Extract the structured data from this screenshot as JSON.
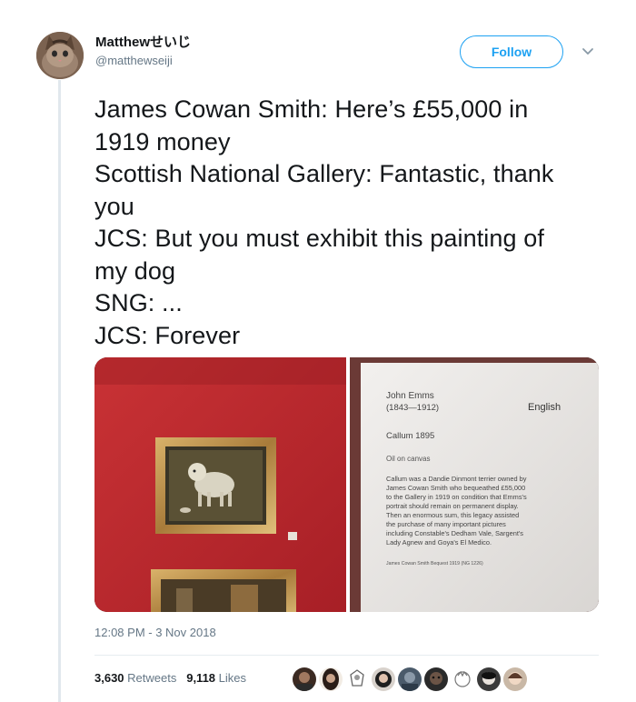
{
  "author": {
    "display_name": "Matthewせいじ",
    "handle": "@matthewseiji",
    "avatar_icon": "cat-avatar"
  },
  "follow_button": {
    "label": "Follow",
    "color": "#1da1f2"
  },
  "more_menu": {
    "icon": "chevron-down-icon"
  },
  "tweet_lines": [
    "James Cowan Smith: Here’s £55,000 in",
    "1919 money",
    "Scottish National Gallery: Fantastic, thank",
    "you",
    "JCS: But you must exhibit this painting of",
    "my dog",
    "SNG: ...",
    "JCS: Forever"
  ],
  "plaque": {
    "artist": "John Emms",
    "dates": "(1843—1912)",
    "language": "English",
    "title": "Callum 1895",
    "medium": "Oil on canvas",
    "description_lines": [
      "Callum was a Dandie Dinmont terrier owned by",
      "James Cowan Smith who bequeathed £55,000",
      "to the Gallery in 1919 on condition that Emms's",
      "portrait should remain on permanent display.",
      "Then an enormous sum, this legacy assisted",
      "the purchase of many important pictures",
      "including Constable's Dedham Vale, Sargent's",
      "Lady Agnew and Goya's El Medico."
    ],
    "credit": "James Cowan Smith Bequest 1919 (NG 1226)"
  },
  "timestamp": "12:08 PM - 3 Nov 2018",
  "stats": {
    "retweets_count": "3,630",
    "retweets_label": "Retweets",
    "likes_count": "9,118",
    "likes_label": "Likes"
  },
  "colors": {
    "gallery_wall": "#b8262d",
    "link_blue": "#1da1f2",
    "muted_text": "#657786"
  }
}
